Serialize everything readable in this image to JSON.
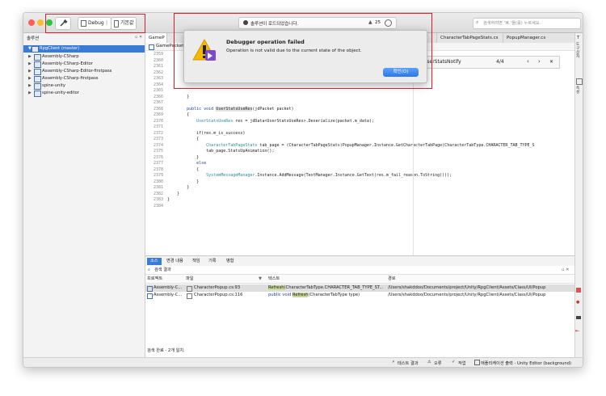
{
  "toolbar": {
    "config_label": "Debug",
    "device_label": "기본값",
    "status_text": "솔루션이 로드되었습니다.",
    "warning_count": "25",
    "search_placeholder": "검색하려면 '⌘.'을(를) 누르세요."
  },
  "solution": {
    "header": "솔루션",
    "root": "RpgClient (master)",
    "items": [
      {
        "label": "Assembly-CSharp"
      },
      {
        "label": "Assembly-CSharp-Editor"
      },
      {
        "label": "Assembly-CSharp-Editor-firstpass"
      },
      {
        "label": "Assembly-CSharp-firstpass"
      },
      {
        "label": "spine-unity"
      },
      {
        "label": "spine-unity-editor"
      }
    ]
  },
  "editor": {
    "tabs": [
      "GameP",
      "CharacterTabPageStats.cs",
      "PopupManager.cs"
    ],
    "breadcrumb": "GamePacketH",
    "find_text": "UserStatsNotify",
    "find_count": "4/4",
    "line_numbers": [
      "2359",
      "2360",
      "2361",
      "2362",
      "2363",
      "2364",
      "2365",
      "2366",
      "2367",
      "2368",
      "2369",
      "2370",
      "2371",
      "2372",
      "2373",
      "2374",
      "2375",
      "2376",
      "2377",
      "2378",
      "2379",
      "2380",
      "2381",
      "2382",
      "2383",
      "2384"
    ],
    "code": {
      "l2367": "        }",
      "l2369a": "        public void ",
      "l2369b": "UserStatsUseRes",
      "l2369c": "(jdPacket packet)",
      "l2370": "        {",
      "l2371a": "            UserStatsUseRes",
      "l2371b": " res = jdData<UserStatsUseRes>.Deserialize(packet.m_data);",
      "l2373": "            if(res.m_is_success)",
      "l2374": "            {",
      "l2375a": "                CharacterTabPageStats",
      "l2375b": " tab_page = (CharacterTabPageStats)PopupManager.Instance.GetCharacterTabPage(CharacterTabType.CHARACTER_TAB_TYPE_S",
      "l2376": "                tab_page.StatsUpAnimation();",
      "l2377": "            }",
      "l2378": "            else",
      "l2379": "            {",
      "l2380a": "                SystemMessageManager",
      "l2380b": ".Instance.AddMessage(TextManager.Instance.GetText(res.m_fail_reason.ToString()));",
      "l2381": "            }",
      "l2382": "        }",
      "l2383": "    }",
      "l2384": "}"
    }
  },
  "dialog": {
    "title": "Debugger operation failed",
    "message": "Operation is not valid due to the current state of the object.",
    "ok_label": "확인(O)"
  },
  "bottom_panel": {
    "tabs": [
      "소스",
      "변경 내용",
      "책임",
      "기록",
      "병합"
    ],
    "search_header": "검색 결과",
    "columns": [
      "프로젝트",
      "파일",
      "텍스트",
      "경로"
    ],
    "rows": [
      {
        "project": "Assembly-C...",
        "file": "CharacterPopup.cs:93",
        "text_highlight": "Refresh",
        "text_rest": "(CharacterTabType.CHARACTER_TAB_TYPE_ST...",
        "path": "/Users/shakddoo/Documents/project/Unity/RpgClient/Assets/Class/UI/Popup"
      },
      {
        "project": "Assembly-C...",
        "file": "CharacterPopup.cs:116",
        "text_prefix": "public void ",
        "text_highlight": "Refresh",
        "text_rest": "(CharacterTabType type)",
        "path": "/Users/shakddoo/Documents/project/Unity/RpgClient/Assets/Class/UI/Popup"
      }
    ],
    "footer": "검색 완료 - 2개 일치."
  },
  "statusbar": {
    "test_results": "테스트 결과",
    "errors": "오류",
    "tasks": "작업",
    "app_output": "애플리케이션 출력 - Unity Editor (background)"
  },
  "right_sidebar": {
    "tab1": "도구 상자",
    "tab2": "속성"
  }
}
